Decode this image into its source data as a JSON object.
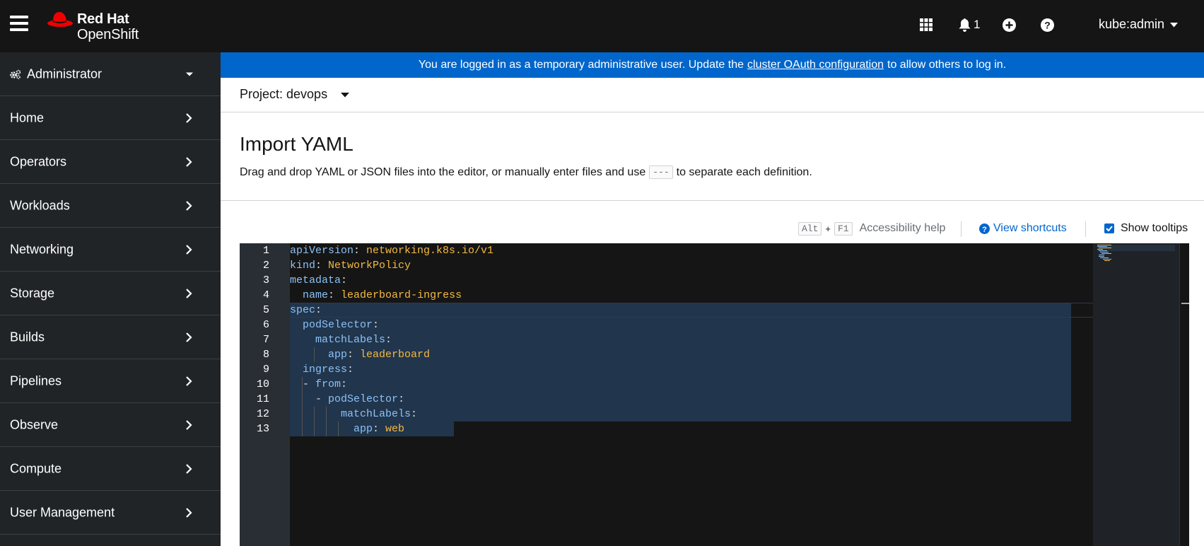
{
  "masthead": {
    "brand_line1": "Red Hat",
    "brand_line2": "OpenShift",
    "notification_count": "1",
    "user": "kube:admin"
  },
  "sidebar": {
    "perspective": "Administrator",
    "items": [
      {
        "label": "Home"
      },
      {
        "label": "Operators"
      },
      {
        "label": "Workloads"
      },
      {
        "label": "Networking"
      },
      {
        "label": "Storage"
      },
      {
        "label": "Builds"
      },
      {
        "label": "Pipelines"
      },
      {
        "label": "Observe"
      },
      {
        "label": "Compute"
      },
      {
        "label": "User Management"
      }
    ]
  },
  "banner": {
    "text_before": "You are logged in as a temporary administrative user. Update the",
    "link": "cluster OAuth configuration",
    "text_after": "to allow others to log in."
  },
  "project": {
    "label": "Project: devops"
  },
  "page": {
    "title": "Import YAML",
    "desc_before": "Drag and drop YAML or JSON files into the editor, or manually enter files and use",
    "desc_code": "---",
    "desc_after": "to separate each definition."
  },
  "toolbar": {
    "key1": "Alt",
    "plus": "+",
    "key2": "F1",
    "accessibility": "Accessibility help",
    "shortcuts": "View shortcuts",
    "tooltips": "Show tooltips",
    "tooltips_checked": true
  },
  "editor": {
    "lines": [
      {
        "n": "1",
        "indent": 0,
        "dash": false,
        "key": "apiVersion",
        "value": "networking.k8s.io/v1"
      },
      {
        "n": "2",
        "indent": 0,
        "dash": false,
        "key": "kind",
        "value": "NetworkPolicy"
      },
      {
        "n": "3",
        "indent": 0,
        "dash": false,
        "key": "metadata",
        "value": ""
      },
      {
        "n": "4",
        "indent": 2,
        "dash": false,
        "key": "name",
        "value": "leaderboard-ingress"
      },
      {
        "n": "5",
        "indent": 0,
        "dash": false,
        "key": "spec",
        "value": ""
      },
      {
        "n": "6",
        "indent": 2,
        "dash": false,
        "key": "podSelector",
        "value": ""
      },
      {
        "n": "7",
        "indent": 4,
        "dash": false,
        "key": "matchLabels",
        "value": ""
      },
      {
        "n": "8",
        "indent": 6,
        "dash": false,
        "key": "app",
        "value": "leaderboard"
      },
      {
        "n": "9",
        "indent": 2,
        "dash": false,
        "key": "ingress",
        "value": ""
      },
      {
        "n": "10",
        "indent": 2,
        "dash": true,
        "key": "from",
        "value": ""
      },
      {
        "n": "11",
        "indent": 4,
        "dash": true,
        "key": "podSelector",
        "value": ""
      },
      {
        "n": "12",
        "indent": 8,
        "dash": false,
        "key": "matchLabels",
        "value": ""
      },
      {
        "n": "13",
        "indent": 10,
        "dash": false,
        "key": "app",
        "value": "web"
      }
    ]
  },
  "colors": {
    "masthead": "#151515",
    "sidebar": "#212427",
    "banner": "#0066cc",
    "link": "#0066cc",
    "yaml_key": "#8bc1f7",
    "yaml_value": "#f4b942"
  }
}
